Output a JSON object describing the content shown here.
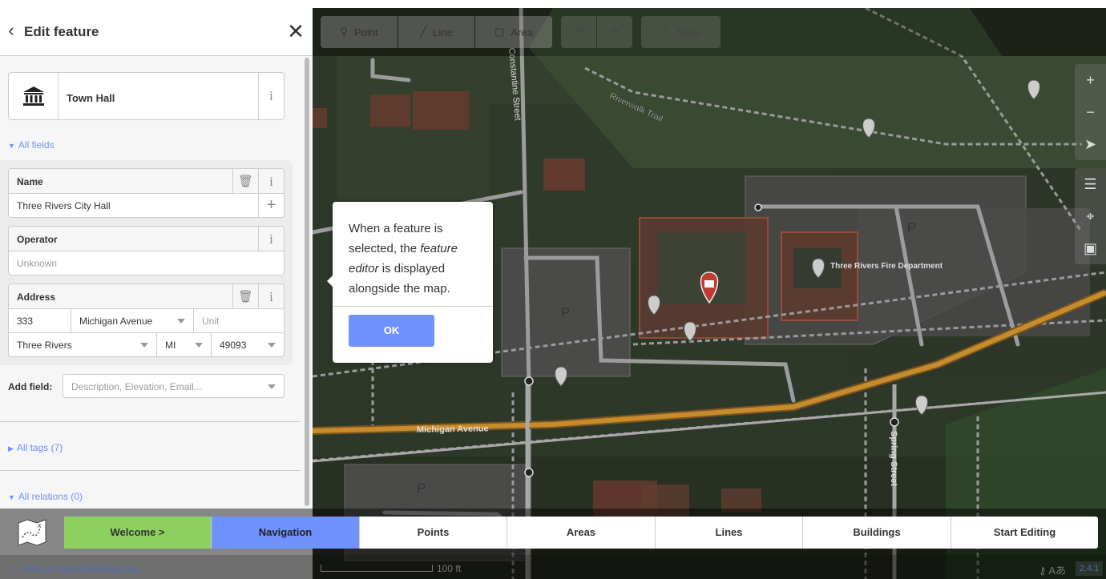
{
  "sidebar": {
    "title": "Edit feature",
    "preset": {
      "label": "Town Hall"
    },
    "all_fields_toggle": "All fields",
    "fields": {
      "name": {
        "label": "Name",
        "value": "Three Rivers City Hall"
      },
      "operator": {
        "label": "Operator",
        "placeholder": "Unknown"
      },
      "address": {
        "label": "Address",
        "housenumber": "333",
        "street": "Michigan Avenue",
        "unit_placeholder": "Unit",
        "city": "Three Rivers",
        "state": "MI",
        "postcode": "49093"
      }
    },
    "add_field": {
      "label": "Add field:",
      "placeholder": "Description, Elevation, Email..."
    },
    "all_tags_toggle": "All tags (7)",
    "all_relations_toggle": "All relations (0)"
  },
  "toolbar": {
    "point": "Point",
    "line": "Line",
    "area": "Area",
    "save": "Save"
  },
  "map_labels": {
    "riverwalk": "Riverwalk Trail",
    "constantine": "Constantine Street",
    "fire_dept": "Three Rivers Fire Department",
    "michigan": "Michigan Avenue",
    "spring": "Spring Street",
    "parking": "P"
  },
  "tooltip": {
    "text_1": "When a feature is selected, the ",
    "text_em": "feature editor",
    "text_2": " is displayed alongside the map.",
    "ok": "OK"
  },
  "walkthrough": {
    "steps": [
      "Welcome >",
      "Navigation",
      "Points",
      "Areas",
      "Lines",
      "Buildings",
      "Start Editing"
    ]
  },
  "footer": {
    "osm_link": "View on openstreetmap.org",
    "scale": "100 ft",
    "version": "2.4.1"
  },
  "colors": {
    "accent": "#7092ff",
    "done": "#8cd05f",
    "road_primary": "#c78b2c"
  }
}
